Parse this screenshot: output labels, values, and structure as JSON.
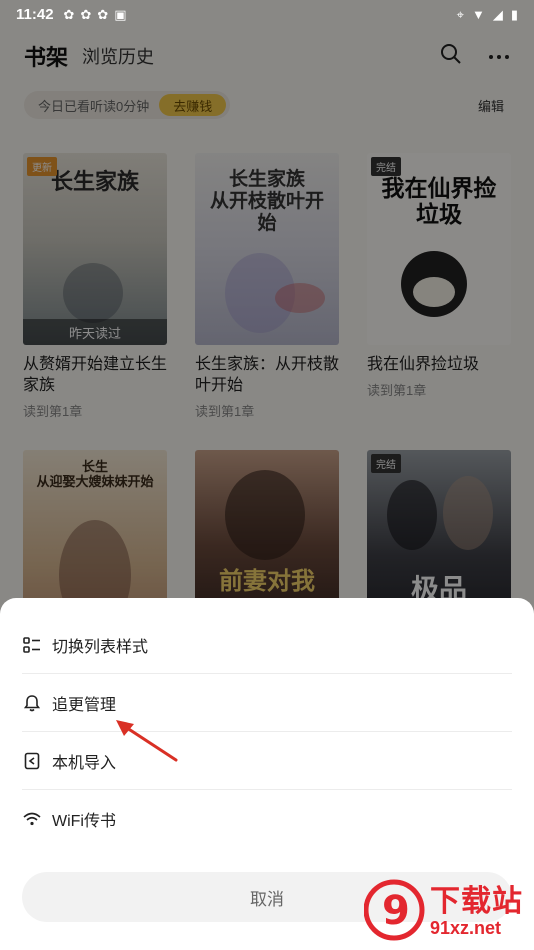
{
  "statusbar": {
    "time": "11:42"
  },
  "header": {
    "title": "书架",
    "tab_history": "浏览历史"
  },
  "readbar": {
    "today_text": "今日已看听读0分钟",
    "earn_label": "去赚钱",
    "edit_label": "编辑"
  },
  "books": [
    {
      "cover_title": "长生家族",
      "badge": "更新",
      "lastread": "昨天读过",
      "name": "从赘婿开始建立长生家族",
      "progress": "读到第1章"
    },
    {
      "cover_title": "长生家族\n从开枝散叶开始",
      "badge": "",
      "lastread": "",
      "name": "长生家族：从开枝散叶开始",
      "progress": "读到第1章"
    },
    {
      "cover_title": "我在仙界捡垃圾",
      "badge": "完结",
      "lastread": "",
      "name": "我在仙界捡垃圾",
      "progress": "读到第1章"
    },
    {
      "cover_title": "长生\n从迎娶大嫂妹妹开始",
      "badge": "",
      "lastread": "",
      "name": "",
      "progress": ""
    },
    {
      "cover_title": "前妻对我",
      "badge": "",
      "lastread": "",
      "name": "",
      "progress": ""
    },
    {
      "cover_title": "极品",
      "badge": "完结",
      "lastread": "",
      "name": "",
      "progress": ""
    }
  ],
  "sheet": {
    "items": [
      {
        "label": "切换列表样式",
        "icon": "list-style-icon"
      },
      {
        "label": "追更管理",
        "icon": "bell-icon"
      },
      {
        "label": "本机导入",
        "icon": "import-icon"
      },
      {
        "label": "WiFi传书",
        "icon": "wifi-icon"
      }
    ],
    "cancel_label": "取消"
  },
  "watermark": {
    "brand": "下载站",
    "url": "91xz.net",
    "logo_text": "9"
  },
  "colors": {
    "accent_yellow": "#f2c94c",
    "badge_orange": "#e8962e",
    "badge_dark": "#333333",
    "arrow_red": "#d93025",
    "watermark_red": "#e3272f"
  }
}
